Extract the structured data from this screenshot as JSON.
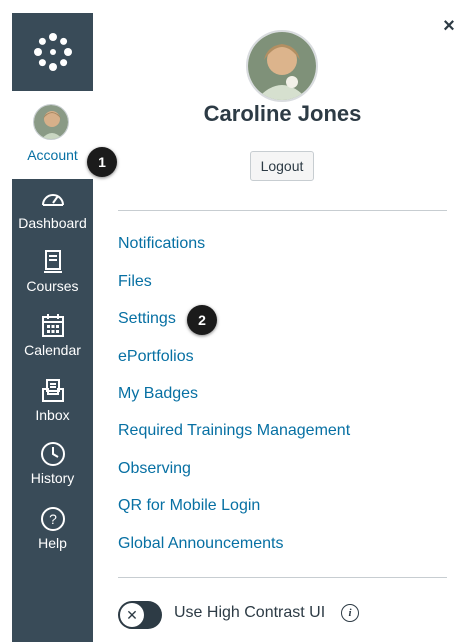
{
  "global_nav": {
    "logo": "canvas-logo-icon",
    "account": {
      "label": "Account",
      "icon": "avatar"
    },
    "items": [
      {
        "label": "Dashboard",
        "icon": "dashboard-icon"
      },
      {
        "label": "Courses",
        "icon": "courses-icon"
      },
      {
        "label": "Calendar",
        "icon": "calendar-icon"
      },
      {
        "label": "Inbox",
        "icon": "inbox-icon"
      },
      {
        "label": "History",
        "icon": "history-icon"
      },
      {
        "label": "Help",
        "icon": "help-icon"
      }
    ]
  },
  "tray": {
    "close_label": "×",
    "user_name": "Caroline Jones",
    "logout_label": "Logout",
    "links": [
      "Notifications",
      "Files",
      "Settings",
      "ePortfolios",
      "My Badges",
      "Required Trainings Management",
      "Observing",
      "QR for Mobile Login",
      "Global Announcements"
    ],
    "high_contrast": {
      "label": "Use High Contrast UI",
      "enabled": false,
      "knob_glyph": "✕"
    },
    "info_glyph": "i"
  },
  "callouts": [
    "1",
    "2"
  ],
  "colors": {
    "nav_bg": "#394B58",
    "link": "#0770A3",
    "text": "#2D3B45",
    "callout_bg": "#1b1b1b"
  }
}
